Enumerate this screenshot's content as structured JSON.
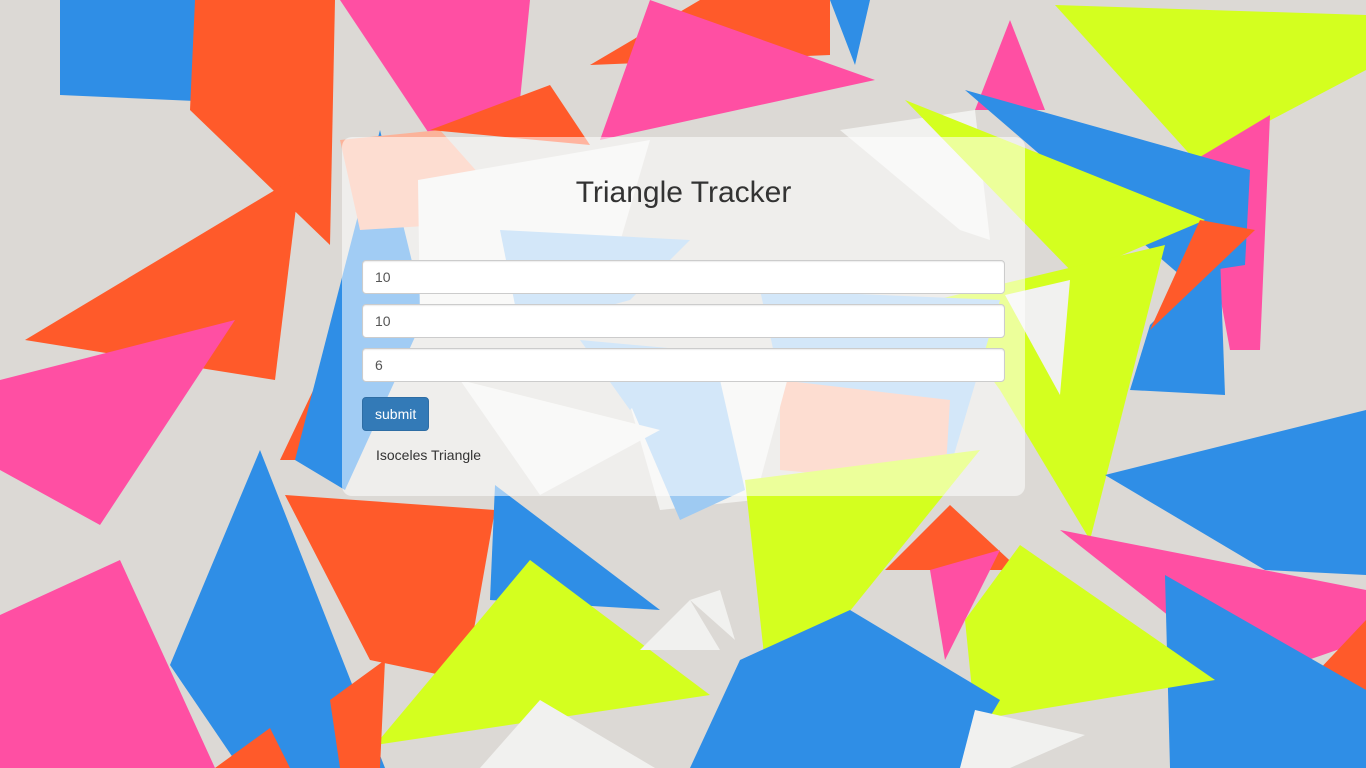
{
  "page": {
    "title": "Triangle Tracker"
  },
  "form": {
    "side1_value": "10",
    "side2_value": "10",
    "side3_value": "6",
    "submit_label": "submit"
  },
  "result": {
    "text": "Isoceles Triangle"
  },
  "colors": {
    "button_bg": "#337ab7",
    "panel_bg": "rgba(255,255,255,0.55)",
    "confetti_pink": "#ff4fa3",
    "confetti_orange": "#ff5a2a",
    "confetti_yellow": "#d4ff1f",
    "confetti_blue": "#2f8ee6",
    "confetti_white": "#f1f1ef"
  }
}
